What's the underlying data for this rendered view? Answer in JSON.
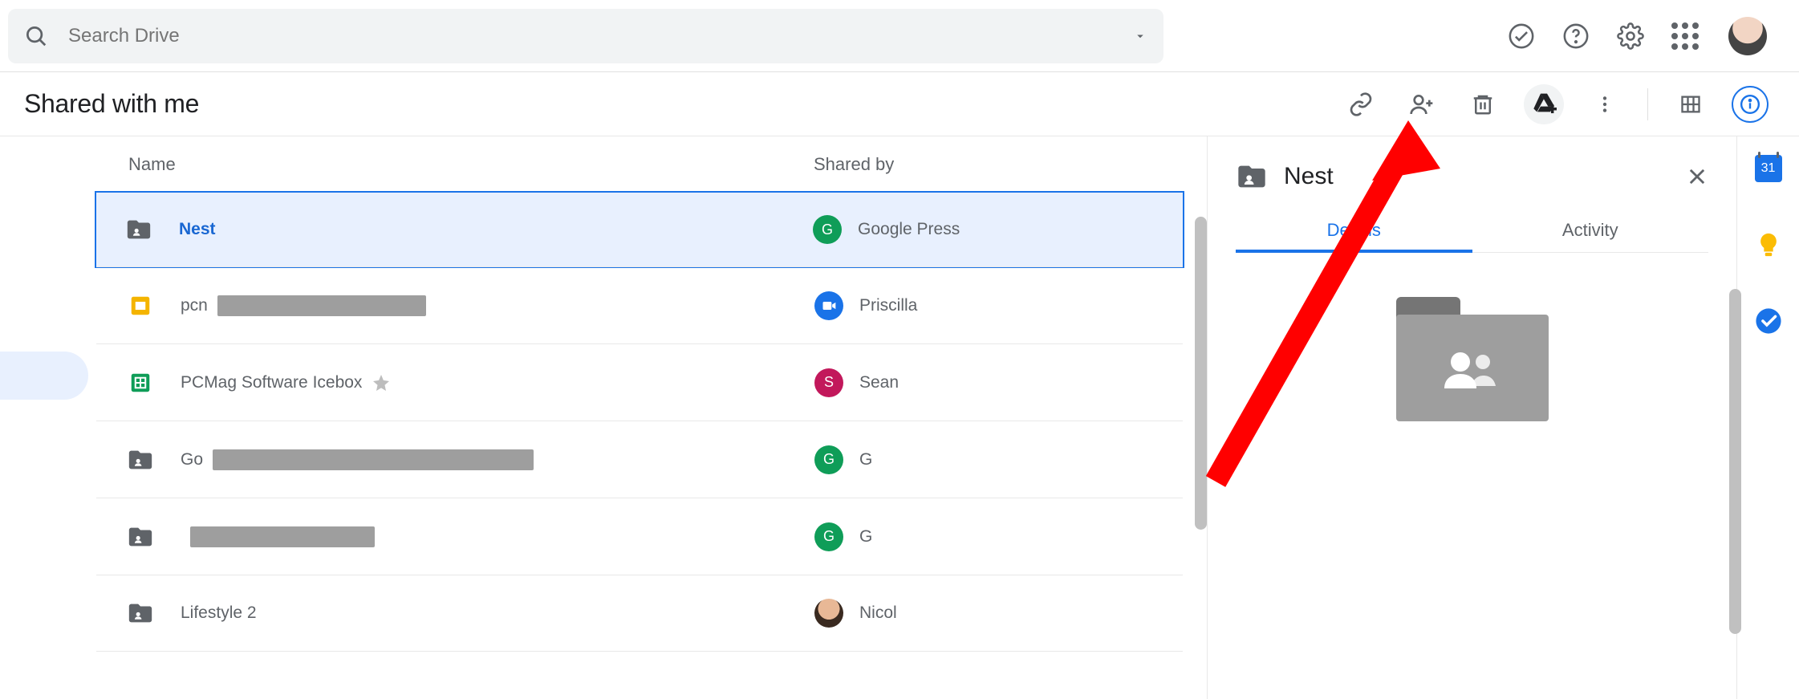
{
  "search": {
    "placeholder": "Search Drive"
  },
  "page": {
    "title": "Shared with me"
  },
  "columns": {
    "name": "Name",
    "shared_by": "Shared by"
  },
  "rows": [
    {
      "name": "Nest",
      "shared_by": "Google Press",
      "selected": true,
      "icon": "shared-folder",
      "avatar": {
        "type": "letter",
        "letter": "G",
        "bg": "#0f9d58"
      },
      "name_color": "sel"
    },
    {
      "name": "pcn",
      "shared_by": "Priscilla",
      "icon": "slides",
      "redact_w": 260,
      "avatar": {
        "type": "meet"
      }
    },
    {
      "name": "PCMag Software Icebox",
      "shared_by": "Sean",
      "icon": "sheets",
      "starred": true,
      "avatar": {
        "type": "letter",
        "letter": "S",
        "bg": "#c2185b"
      }
    },
    {
      "name": "Go",
      "shared_by": "G",
      "icon": "shared-folder",
      "redact_w": 400,
      "avatar": {
        "type": "letter",
        "letter": "G",
        "bg": "#0f9d58"
      }
    },
    {
      "name": "",
      "shared_by": "G",
      "icon": "shared-folder",
      "redact_w": 230,
      "avatar": {
        "type": "letter",
        "letter": "G",
        "bg": "#0f9d58"
      }
    },
    {
      "name": "Lifestyle 2",
      "shared_by": "Nicol",
      "icon": "shared-folder",
      "avatar": {
        "type": "photo"
      }
    }
  ],
  "right_panel": {
    "title": "Nest",
    "tabs": {
      "details": "Details",
      "activity": "Activity"
    }
  },
  "side_apps": {
    "calendar_day": "31"
  }
}
